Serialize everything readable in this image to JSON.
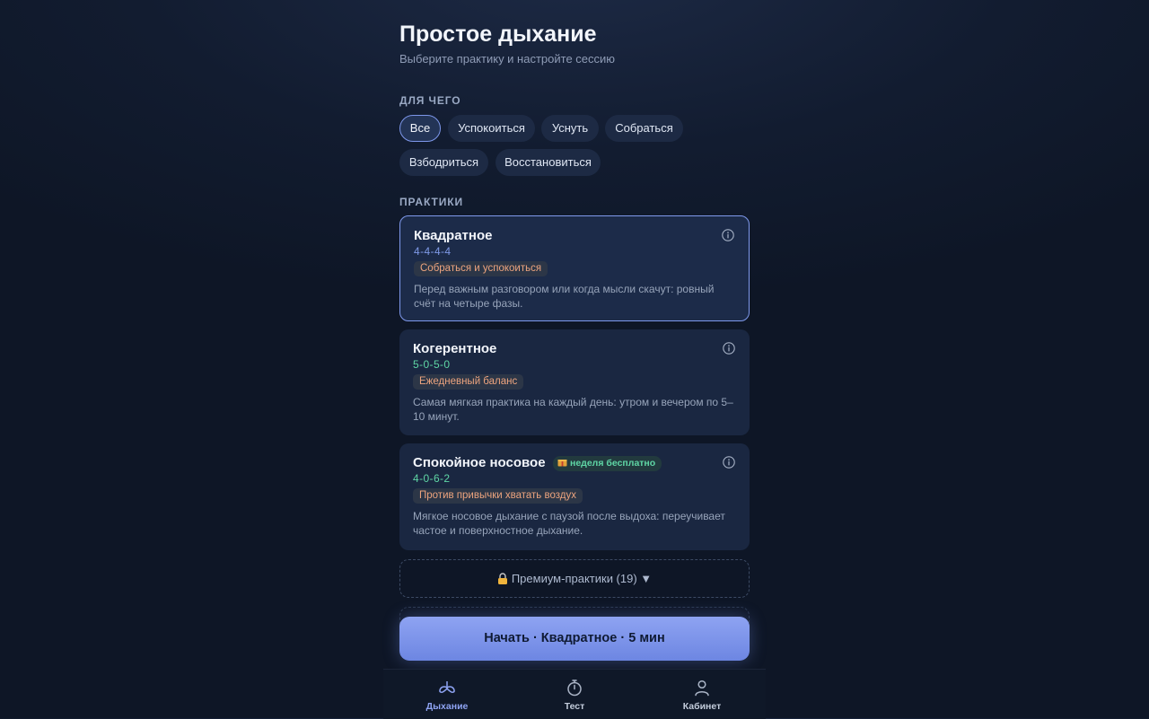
{
  "header": {
    "title": "Простое дыхание",
    "subtitle": "Выберите практику и настройте сессию"
  },
  "filters": {
    "label": "ДЛЯ ЧЕГО",
    "chips": [
      "Все",
      "Успокоиться",
      "Уснуть",
      "Собраться",
      "Взбодриться",
      "Восстановиться"
    ],
    "selected": "Все"
  },
  "practices": {
    "label": "ПРАКТИКИ",
    "items": [
      {
        "title": "Квадратное",
        "pattern": "4-4-4-4",
        "tag": "Собраться и успокоиться",
        "description": "Перед важным разговором или когда мысли скачут: ровный счёт на четыре фазы.",
        "selected": true
      },
      {
        "title": "Когерентное",
        "pattern": "5-0-5-0",
        "tag": "Ежедневный баланс",
        "description": "Самая мягкая практика на каждый день: утром и вечером по 5–10 минут.",
        "selected": false
      },
      {
        "title": "Спокойное носовое",
        "pattern": "4-0-6-2",
        "tag": "Против привычки хватать воздух",
        "description": "Мягкое носовое дыхание с паузой после выдоха: переучивает частое и поверхностное дыхание.",
        "badge": "неделя бесплатно",
        "selected": false
      }
    ]
  },
  "premium": {
    "label": "Премиум-практики (19) ▼"
  },
  "start_button": {
    "label": "Начать · Квадратное · 5 мин"
  },
  "tabbar": {
    "items": [
      {
        "label": "Дыхание",
        "icon": "lungs-icon",
        "active": true
      },
      {
        "label": "Тест",
        "icon": "stopwatch-icon",
        "active": false
      },
      {
        "label": "Кабинет",
        "icon": "person-icon",
        "active": false
      }
    ]
  },
  "colors": {
    "accent": "#8ea3f2",
    "pattern_blue": "#7f9ae8",
    "pattern_green": "#5fd6a5",
    "tag_text": "#eda47e",
    "background": "#0f1828"
  }
}
